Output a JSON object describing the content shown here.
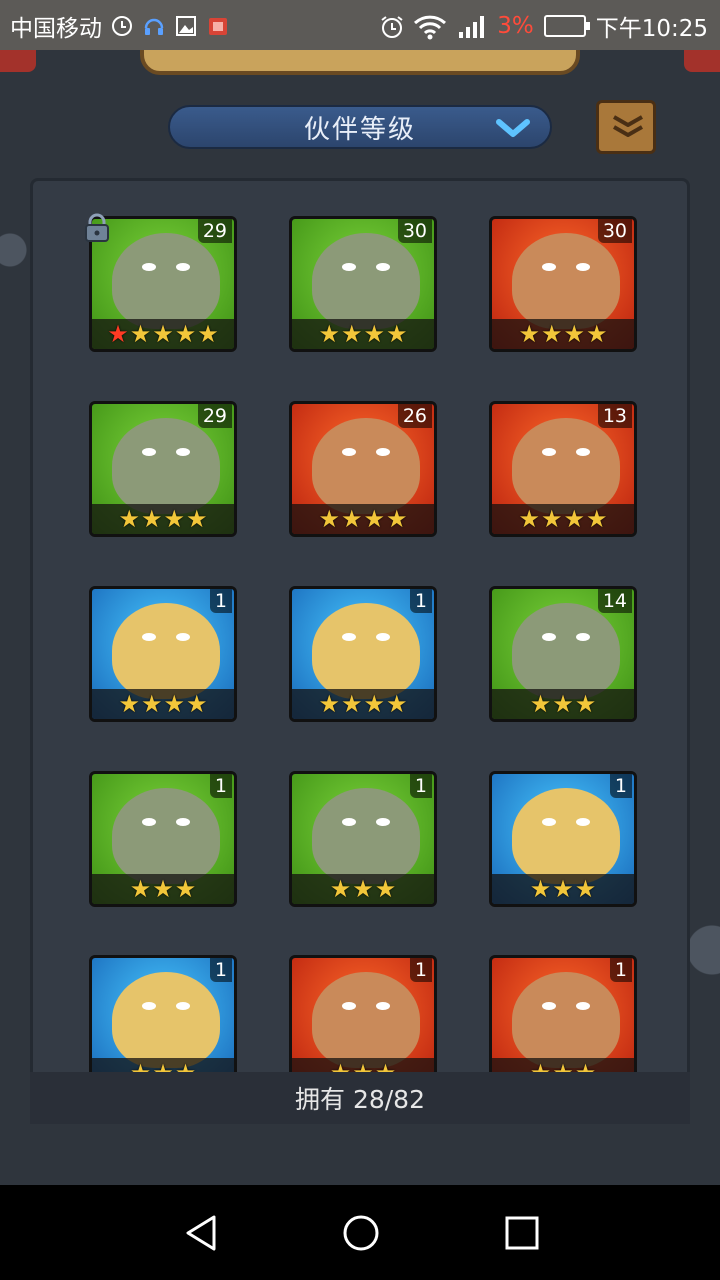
{
  "status_bar": {
    "carrier": "中国移动",
    "battery_percent": "3%",
    "time": "下午10:25",
    "icons": [
      "clock-icon",
      "headset-icon",
      "image-icon",
      "app-icon",
      "alarm-icon",
      "wifi-icon",
      "signal-icon",
      "battery-icon"
    ]
  },
  "header": {
    "sort_dropdown_label": "伙伴等级",
    "sort_dropdown_icon": "chevron-down-icon",
    "side_button_icon": "book-icon"
  },
  "heroes": [
    {
      "level": "29",
      "stars": 5,
      "red_stars": 1,
      "bg": "green",
      "locked": true
    },
    {
      "level": "30",
      "stars": 4,
      "red_stars": 0,
      "bg": "green",
      "locked": false
    },
    {
      "level": "30",
      "stars": 4,
      "red_stars": 0,
      "bg": "red",
      "locked": false
    },
    {
      "level": "29",
      "stars": 4,
      "red_stars": 0,
      "bg": "green",
      "locked": false
    },
    {
      "level": "26",
      "stars": 4,
      "red_stars": 0,
      "bg": "red",
      "locked": false
    },
    {
      "level": "13",
      "stars": 4,
      "red_stars": 0,
      "bg": "red",
      "locked": false
    },
    {
      "level": "1",
      "stars": 4,
      "red_stars": 0,
      "bg": "blue",
      "locked": false
    },
    {
      "level": "1",
      "stars": 4,
      "red_stars": 0,
      "bg": "blue",
      "locked": false
    },
    {
      "level": "14",
      "stars": 3,
      "red_stars": 0,
      "bg": "green",
      "locked": false
    },
    {
      "level": "1",
      "stars": 3,
      "red_stars": 0,
      "bg": "green",
      "locked": false
    },
    {
      "level": "1",
      "stars": 3,
      "red_stars": 0,
      "bg": "green",
      "locked": false
    },
    {
      "level": "1",
      "stars": 3,
      "red_stars": 0,
      "bg": "blue",
      "locked": false
    },
    {
      "level": "1",
      "stars": 3,
      "red_stars": 0,
      "bg": "blue",
      "locked": false
    },
    {
      "level": "1",
      "stars": 3,
      "red_stars": 0,
      "bg": "red",
      "locked": false
    },
    {
      "level": "1",
      "stars": 3,
      "red_stars": 0,
      "bg": "red",
      "locked": false
    }
  ],
  "footer": {
    "owned_label": "拥有 28/82"
  },
  "nav": {
    "icons": [
      "back-icon",
      "home-icon",
      "recents-icon"
    ]
  },
  "colors": {
    "panel_bg": "#343b45",
    "dropdown_bg": "#3a5b8c",
    "star": "#f2c63a",
    "star_red": "#ff3b24",
    "battery_low": "#ff4b3a"
  }
}
